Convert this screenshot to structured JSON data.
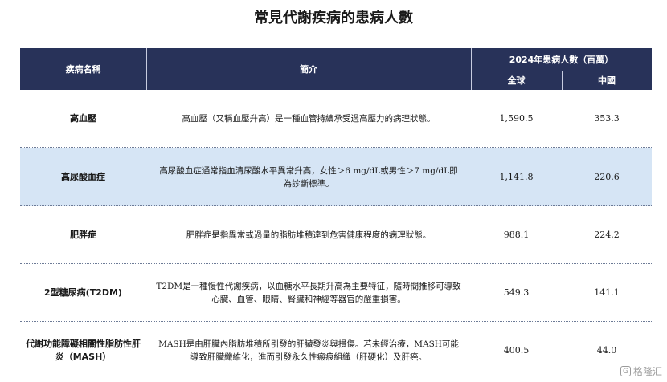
{
  "title": "常見代謝疾病的患病人數",
  "header": {
    "disease_name": "疾病名稱",
    "intro": "簡介",
    "patients_2024": "2024年患病人數（百萬）",
    "global": "全球",
    "china": "中國"
  },
  "rows": [
    {
      "name": "高血壓",
      "desc": "高血壓（又稱血壓升高）是一種血管持續承受過高壓力的病理狀態。",
      "global": "1,590.5",
      "china": "353.3"
    },
    {
      "name": "高尿酸血症",
      "desc": "高尿酸血症通常指血清尿酸水平異常升高，女性＞6 mg/dL或男性＞7 mg/dL即為診斷標準。",
      "global": "1,141.8",
      "china": "220.6"
    },
    {
      "name": "肥胖症",
      "desc": "肥胖症是指異常或過量的脂肪堆積達到危害健康程度的病理狀態。",
      "global": "988.1",
      "china": "224.2"
    },
    {
      "name": "2型糖尿病(T2DM)",
      "desc": "T2DM是一種慢性代謝疾病，以血糖水平長期升高為主要特征，隨時間推移可導致心臟、血管、眼睛、腎臟和神經等器官的嚴重損害。",
      "global": "549.3",
      "china": "141.1"
    },
    {
      "name": "代謝功能障礙相關性脂肪性肝炎（MASH）",
      "desc": "MASH是由肝臟內脂肪堆積所引發的肝臟發炎與損傷。若未經治療，MASH可能導致肝臟纖維化，進而引發永久性瘢痕組織（肝硬化）及肝癌。",
      "global": "400.5",
      "china": "44.0"
    }
  ],
  "watermark": {
    "text": "格隆汇",
    "logo": "G"
  }
}
